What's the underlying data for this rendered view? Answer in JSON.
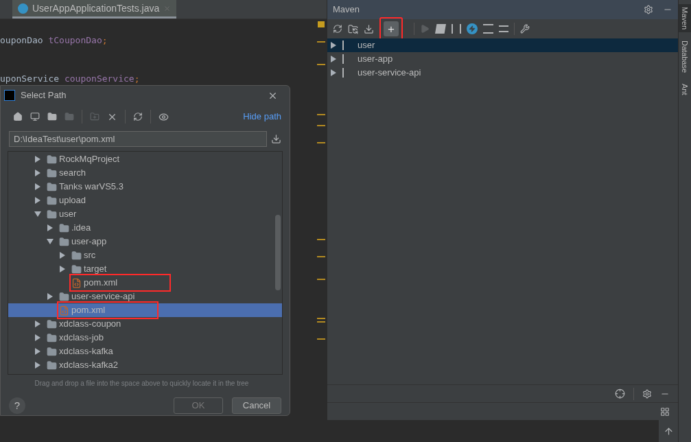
{
  "editor": {
    "tabs": [
      {
        "label": "UserAppApplicationTests.java",
        "selected": true
      }
    ],
    "code_lines": [
      [
        {
          "text": "ouponDao ",
          "kind": "type"
        },
        {
          "text": "tCouponDao",
          "kind": "field"
        },
        {
          "text": ";",
          "kind": "punct"
        }
      ],
      [
        {
          "text": "uponService ",
          "kind": "type"
        },
        {
          "text": "couponService",
          "kind": "field"
        },
        {
          "text": ";",
          "kind": "punct"
        }
      ]
    ]
  },
  "dialog": {
    "title": "Select Path",
    "hide_path_link": "Hide path",
    "path": "D:\\IdeaTest\\user\\pom.xml",
    "tree": [
      {
        "label": "RockMqProject",
        "kind": "folder",
        "expanded": false,
        "selected": false,
        "annotated": false
      },
      {
        "label": "search",
        "kind": "folder",
        "expanded": false,
        "selected": false,
        "annotated": false
      },
      {
        "label": "Tanks warVS5.3",
        "kind": "folder",
        "expanded": false,
        "selected": false,
        "annotated": false
      },
      {
        "label": "upload",
        "kind": "folder",
        "expanded": false,
        "selected": false,
        "annotated": false
      },
      {
        "label": "user",
        "kind": "folder",
        "expanded": true,
        "selected": false,
        "annotated": false,
        "children": [
          {
            "label": ".idea",
            "kind": "folder",
            "expanded": false,
            "selected": false,
            "annotated": false
          },
          {
            "label": "user-app",
            "kind": "folder",
            "expanded": true,
            "selected": false,
            "annotated": false,
            "children": [
              {
                "label": "src",
                "kind": "folder",
                "expanded": false,
                "selected": false,
                "annotated": false
              },
              {
                "label": "target",
                "kind": "folder",
                "expanded": false,
                "selected": false,
                "annotated": false
              },
              {
                "label": "pom.xml",
                "kind": "pom",
                "selected": false,
                "annotated": true
              }
            ]
          },
          {
            "label": "user-service-api",
            "kind": "folder",
            "expanded": false,
            "selected": false,
            "annotated": false
          },
          {
            "label": "pom.xml",
            "kind": "pom",
            "selected": true,
            "annotated": true
          }
        ]
      },
      {
        "label": "xdclass-coupon",
        "kind": "folder",
        "expanded": false,
        "selected": false,
        "annotated": false
      },
      {
        "label": "xdclass-job",
        "kind": "folder",
        "expanded": false,
        "selected": false,
        "annotated": false
      },
      {
        "label": "xdclass-kafka",
        "kind": "folder",
        "expanded": false,
        "selected": false,
        "annotated": false
      },
      {
        "label": "xdclass-kafka2",
        "kind": "folder",
        "expanded": false,
        "selected": false,
        "annotated": false
      }
    ],
    "hint": "Drag and drop a file into the space above to quickly locate it in the tree",
    "help_label": "?",
    "buttons": [
      {
        "label": "OK",
        "disabled": true
      },
      {
        "label": "Cancel",
        "disabled": false
      }
    ]
  },
  "maven": {
    "title": "Maven",
    "add_button": {
      "label": "+",
      "annotated": true
    },
    "projects": [
      {
        "label": "user",
        "selected": true
      },
      {
        "label": "user-app",
        "selected": false
      },
      {
        "label": "user-service-api",
        "selected": false
      }
    ]
  },
  "side_tabs": [
    {
      "label": "Maven",
      "selected": true
    },
    {
      "label": "Database",
      "selected": false
    },
    {
      "label": "Ant",
      "selected": false
    }
  ]
}
